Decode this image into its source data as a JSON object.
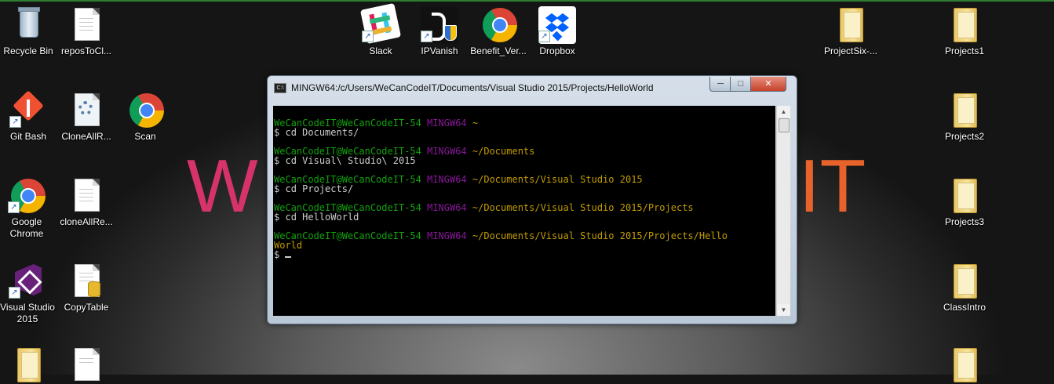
{
  "watermark": {
    "left": "W",
    "right": "IT"
  },
  "desktop": {
    "icons": {
      "recycle_bin": "Recycle Bin",
      "repos_to_cl": "reposToCl...",
      "slack": "Slack",
      "ipvanish": "IPVanish",
      "benefit_ver": "Benefit_Ver...",
      "dropbox": "Dropbox",
      "project_six": "ProjectSix-...",
      "projects1": "Projects1",
      "git_bash": "Git Bash",
      "clone_all_r": "CloneAllR...",
      "scan": "Scan",
      "projects2": "Projects2",
      "google_chrome": "Google Chrome",
      "clone_all_re": "cloneAllRe...",
      "projects3": "Projects3",
      "visual_studio": "Visual Studio 2015",
      "copy_table": "CopyTable",
      "class_intro": "ClassIntro"
    }
  },
  "terminal": {
    "title": "MINGW64:/c/Users/WeCanCodeIT/Documents/Visual Studio 2015/Projects/HelloWorld",
    "buttons": {
      "minimize": "─",
      "maximize": "□",
      "close": "✕"
    },
    "prompt_user": "WeCanCodeIT@WeCanCodeIT-54",
    "prompt_shell": "MINGW64",
    "prompt_symbol": "$",
    "lines": [
      {
        "path": "~",
        "command": "cd Documents/"
      },
      {
        "path": "~/Documents",
        "command": "cd Visual\\ Studio\\ 2015"
      },
      {
        "path": "~/Documents/Visual Studio 2015",
        "command": "cd Projects/"
      },
      {
        "path": "~/Documents/Visual Studio 2015/Projects",
        "command": "cd HelloWorld"
      }
    ],
    "last_path_line1": "~/Documents/Visual Studio 2015/Projects/Hello",
    "last_path_line2": "World"
  },
  "colors": {
    "prompt_user": "#13a10e",
    "prompt_shell": "#881798",
    "prompt_path": "#c19c00",
    "watermark_left": "#d6336c",
    "watermark_right": "#e8632b"
  }
}
